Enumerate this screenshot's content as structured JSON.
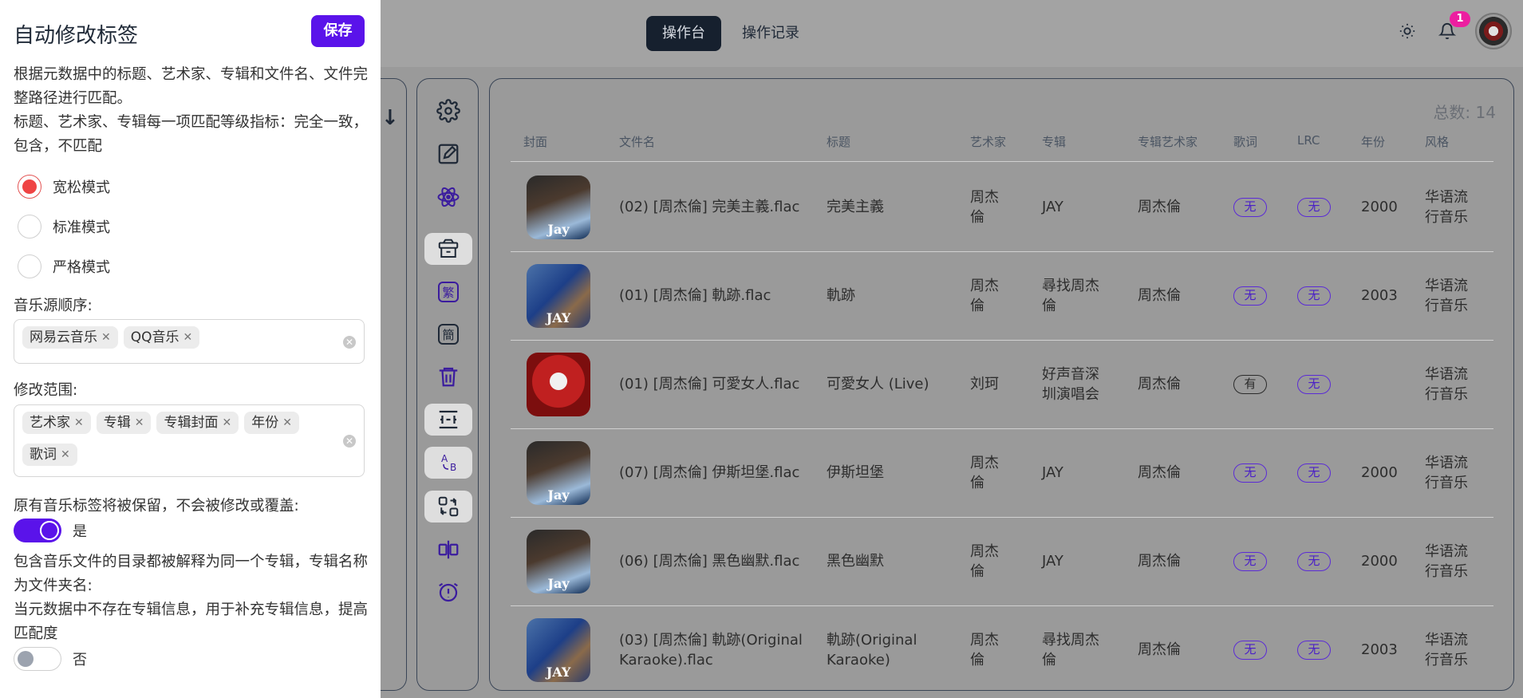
{
  "drawer": {
    "title": "自动修改标签",
    "save_label": "保存",
    "desc1": "根据元数据中的标题、艺术家、专辑和文件名、文件完整路径进行匹配。",
    "desc2": "标题、艺术家、专辑每一项匹配等级指标：完全一致，包含，不匹配",
    "modes": [
      "宽松模式",
      "标准模式",
      "严格模式"
    ],
    "selected_mode": "宽松模式",
    "source_order_label": "音乐源顺序:",
    "sources": [
      "网易云音乐",
      "QQ音乐"
    ],
    "scope_label": "修改范围:",
    "scope": [
      "艺术家",
      "专辑",
      "专辑封面",
      "年份",
      "歌词"
    ],
    "preserve_text": "原有音乐标签将被保留，不会被修改或覆盖:",
    "preserve_value": "是",
    "dir_text1": "包含音乐文件的目录都被解释为同一个专辑，专辑名称为文件夹名:",
    "dir_text2": "当元数据中不存在专辑信息，用于补充专辑信息，提高匹配度",
    "dir_value": "否"
  },
  "header": {
    "tabs": [
      "操作台",
      "操作记录"
    ],
    "active_tab": "操作台",
    "notification_count": "1",
    "icons": [
      "sun-icon",
      "bell-icon",
      "avatar"
    ]
  },
  "toolbar": {
    "icons": [
      "gear-icon",
      "edit-icon",
      "atom-icon",
      "archive-icon",
      "traditional-chinese-icon",
      "simplified-chinese-icon",
      "trash-icon",
      "columns-icon",
      "a-to-b-icon",
      "swap-icon",
      "split-icon",
      "alarm-icon"
    ],
    "trad_label": "繁",
    "simp_label": "簡"
  },
  "table": {
    "total_label": "总数:",
    "total": "14",
    "columns": [
      "封面",
      "文件名",
      "标题",
      "艺术家",
      "专辑",
      "专辑艺术家",
      "歌词",
      "LRC",
      "年份",
      "风格"
    ],
    "rows": [
      {
        "cover_caption": "Jay",
        "filename": "(02) [周杰倫] 完美主義.flac",
        "title": "完美主義",
        "artist": "周杰倫",
        "album": "JAY",
        "album_artist": "周杰倫",
        "lyrics": "无",
        "lrc": "无",
        "year": "2000",
        "genre": "华语流行音乐"
      },
      {
        "cover_caption": "JAY",
        "filename": "(01) [周杰倫] 軌跡.flac",
        "title": "軌跡",
        "artist": "周杰倫",
        "album": "尋找周杰倫",
        "album_artist": "周杰倫",
        "lyrics": "无",
        "lrc": "无",
        "year": "2003",
        "genre": "华语流行音乐"
      },
      {
        "cover_caption": "",
        "filename": "(01) [周杰倫] 可愛女人.flac",
        "title": "可愛女人 (Live)",
        "artist": "刘珂",
        "album": "好声音深圳演唱会",
        "album_artist": "周杰倫",
        "lyrics": "有",
        "lrc": "无",
        "year": "",
        "genre": "华语流行音乐"
      },
      {
        "cover_caption": "Jay",
        "filename": "(07) [周杰倫] 伊斯坦堡.flac",
        "title": "伊斯坦堡",
        "artist": "周杰倫",
        "album": "JAY",
        "album_artist": "周杰倫",
        "lyrics": "无",
        "lrc": "无",
        "year": "2000",
        "genre": "华语流行音乐"
      },
      {
        "cover_caption": "Jay",
        "filename": "(06) [周杰倫] 黑色幽默.flac",
        "title": "黑色幽默",
        "artist": "周杰倫",
        "album": "JAY",
        "album_artist": "周杰倫",
        "lyrics": "无",
        "lrc": "无",
        "year": "2000",
        "genre": "华语流行音乐"
      },
      {
        "cover_caption": "JAY",
        "filename": "(03) [周杰倫] 軌跡(Original Karaoke).flac",
        "title": "軌跡(Original Karaoke)",
        "artist": "周杰倫",
        "album": "尋找周杰倫",
        "album_artist": "周杰倫",
        "lyrics": "无",
        "lrc": "无",
        "year": "2003",
        "genre": "华语流行音乐"
      }
    ]
  }
}
